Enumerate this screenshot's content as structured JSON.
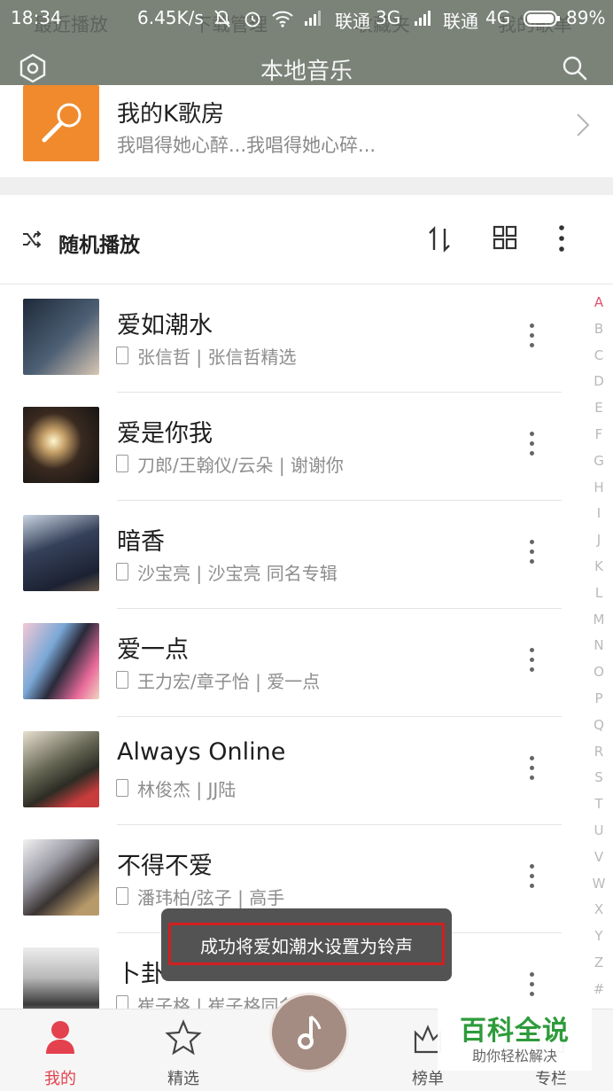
{
  "status_bar": {
    "time": "18:34",
    "speed": "6.45K/s",
    "carrier1": "联通",
    "network1": "3G",
    "carrier2": "联通",
    "network2": "4G",
    "battery": "89%"
  },
  "underlying_tabs": [
    "最近播放",
    "下载管理",
    "收藏夹",
    "我的歌单"
  ],
  "header": {
    "title": "本地音乐"
  },
  "k_room": {
    "title": "我的K歌房",
    "subtitle": "我唱得她心醉...我唱得她心碎..."
  },
  "toolbar": {
    "shuffle_label": "随机播放"
  },
  "songs": [
    {
      "title": "爱如潮水",
      "meta": "张信哲 | 张信哲精选",
      "art_color": "#3d4a5a"
    },
    {
      "title": "爱是你我",
      "meta": "刀郎/王翰仪/云朵 | 谢谢你",
      "art_color": "#2a2420"
    },
    {
      "title": "暗香",
      "meta": "沙宝亮 | 沙宝亮 同名专辑",
      "art_color": "#3a4656"
    },
    {
      "title": "爱一点",
      "meta": "王力宏/章子怡 | 爱一点",
      "art_color": "#c86a82"
    },
    {
      "title": "Always Online",
      "meta": "林俊杰 | JJ陆",
      "art_color": "#5a5a48"
    },
    {
      "title": "不得不爱",
      "meta": "潘玮柏/弦子 | 高手",
      "art_color": "#7a7a80"
    },
    {
      "title": "卜卦",
      "meta": "崔子格 | 崔子格同名专集",
      "art_color": "#909090"
    }
  ],
  "alphabet": [
    "A",
    "B",
    "C",
    "D",
    "E",
    "F",
    "G",
    "H",
    "I",
    "J",
    "K",
    "L",
    "M",
    "N",
    "O",
    "P",
    "Q",
    "R",
    "S",
    "T",
    "U",
    "V",
    "W",
    "X",
    "Y",
    "Z",
    "#"
  ],
  "toast": {
    "message": "成功将爱如潮水设置为铃声"
  },
  "bottom_nav": {
    "items": [
      {
        "label": "我的",
        "icon": "person-icon",
        "active": true
      },
      {
        "label": "精选",
        "icon": "star-icon",
        "active": false
      },
      {
        "label": "榜单",
        "icon": "crown-icon",
        "active": false
      },
      {
        "label": "专栏",
        "icon": "column-icon",
        "active": false
      }
    ],
    "center_icon": "music-note-icon"
  },
  "watermark": {
    "title": "百科全说",
    "subtitle": "助你轻松解决"
  },
  "colors": {
    "accent": "#e4414f",
    "header_bg": "#767e74",
    "toast_border": "#d21f1f",
    "alphabet_active": "#e05070"
  }
}
